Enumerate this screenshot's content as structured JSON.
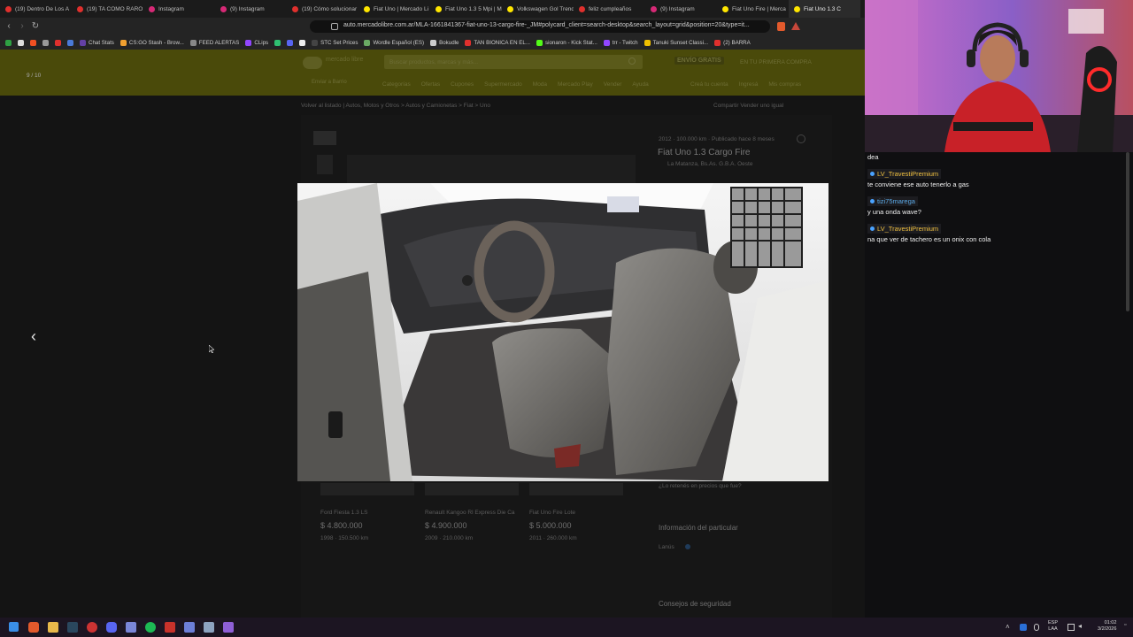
{
  "browser": {
    "tabs": [
      {
        "title": "(19) Dentro De Los A",
        "color": "#e0302d"
      },
      {
        "title": "(19) TA COMO RARO",
        "color": "#e0302d"
      },
      {
        "title": "Instagram",
        "color": "#d62976"
      },
      {
        "title": "(9) Instagram",
        "color": "#d62976"
      },
      {
        "title": "(19) Cómo solucionar",
        "color": "#e0302d"
      },
      {
        "title": "Fiat Uno | Mercado Li",
        "color": "#ffe600"
      },
      {
        "title": "Fiat Uno 1.3 5 Mpi | M",
        "color": "#ffe600"
      },
      {
        "title": "Volkswagen Gol Trend",
        "color": "#ffe600"
      },
      {
        "title": "feliz cumpleaños",
        "color": "#e0302d"
      },
      {
        "title": "(9) Instagram",
        "color": "#d62976"
      },
      {
        "title": "Fiat Uno Fire | Merca",
        "color": "#ffe600"
      },
      {
        "title": "Fiat Uno 1.3 C",
        "color": "#ffe600",
        "active": true
      }
    ],
    "url": "auto.mercadolibre.com.ar/MLA-1661841367-fiat-uno-13-cargo-fire-_JM#polycard_client=search-desktop&search_layout=grid&position=20&type=it...",
    "bookmarks": [
      {
        "label": "",
        "color": "#2ea043"
      },
      {
        "label": "",
        "color": "#dddddd"
      },
      {
        "label": "",
        "color": "#f25022"
      },
      {
        "label": "",
        "color": "#999999"
      },
      {
        "label": "",
        "color": "#e0302d"
      },
      {
        "label": "",
        "color": "#4a7ad8"
      },
      {
        "label": "Chat Stats",
        "color": "#6441a5"
      },
      {
        "label": "CS:GO Stash - Brow...",
        "color": "#f0a030"
      },
      {
        "label": "FEED ALERTAS",
        "color": "#888888"
      },
      {
        "label": "CLips",
        "color": "#9146ff"
      },
      {
        "label": "",
        "color": "#2fbf71"
      },
      {
        "label": "",
        "color": "#5865f2"
      },
      {
        "label": "",
        "color": "#eeeeee"
      },
      {
        "label": "STC Set Prices",
        "color": "#444444"
      },
      {
        "label": "Wordle Español (ES)",
        "color": "#6aaa64"
      },
      {
        "label": "Bokudle",
        "color": "#cccccc"
      },
      {
        "label": "TAN BIONICA EN EL...",
        "color": "#e0302d"
      },
      {
        "label": "sionaron - Kick Stat...",
        "color": "#53fc18"
      },
      {
        "label": "trr - Twitch",
        "color": "#9146ff"
      },
      {
        "label": "Tanuki Sunset Classi...",
        "color": "#f0c000"
      },
      {
        "label": "(2) BARRA",
        "color": "#e0302d"
      }
    ]
  },
  "page": {
    "image_counter": "9 / 10",
    "header": {
      "logo_text": "mercado libre",
      "search_placeholder": "Buscar productos, marcas y más...",
      "shipping_promo": "ENVÍO GRATIS",
      "shipping_promo_suffix": "EN TU PRIMERA COMPRA",
      "location": "Enviar a Barrio",
      "nav_items": [
        "Categorías",
        "Ofertas",
        "Cupones",
        "Supermercado",
        "Moda",
        "Mercado Play",
        "Vender",
        "Ayuda"
      ],
      "account_items": [
        "Creá tu cuenta",
        "Ingresá",
        "Mis compras"
      ]
    },
    "listing": {
      "breadcrumb": "Volver al listado  |  Autos, Motos y Otros > Autos y Camionetas > Fiat > Uno",
      "meta": "2012 · 100.000 km · Publicado hace 8 meses",
      "title": "Fiat Uno 1.3 Cargo Fire",
      "location": "La Matanza, Bs.As. G.B.A. Oeste",
      "share": "Compartir  Vender uno igual",
      "question": "¿Lo retenés en precios que fue?",
      "seller_section": "Información del particular",
      "seller_location": "Lanús",
      "safety": "Consejos de seguridad",
      "related": [
        {
          "title": "Ford Fiesta 1.3 LS",
          "price": "$ 4.800.000",
          "details": "1998 · 150.500 km"
        },
        {
          "title": "Renault Kangoo Rl Express Die Ca",
          "price": "$ 4.900.000",
          "details": "2009 · 210.000 km"
        },
        {
          "title": "Fiat Uno Fire Lote",
          "price": "$ 5.000.000",
          "details": "2011 · 260.000 km"
        }
      ]
    },
    "nav": {
      "prev_icon": "‹",
      "next_icon": "›"
    }
  },
  "stream": {
    "chat": [
      {
        "type": "message",
        "text": "dea"
      },
      {
        "type": "user",
        "name": "LV_TravestiPremium",
        "color": "#f0c040"
      },
      {
        "type": "message",
        "text": "te conviene ese auto tenerlo a gas"
      },
      {
        "type": "user",
        "name": "tizi75marega",
        "color": "#5aa9e6"
      },
      {
        "type": "message",
        "text": "y una onda wave?"
      },
      {
        "type": "user",
        "name": "LV_TravestiPremium",
        "color": "#f0c040"
      },
      {
        "type": "message",
        "text": "na que ver de tachero es un onix con cola"
      }
    ]
  },
  "taskbar": {
    "lang_top": "ESP",
    "lang_bottom": "LAA",
    "time": "01:02",
    "date": "3/2/2026"
  }
}
